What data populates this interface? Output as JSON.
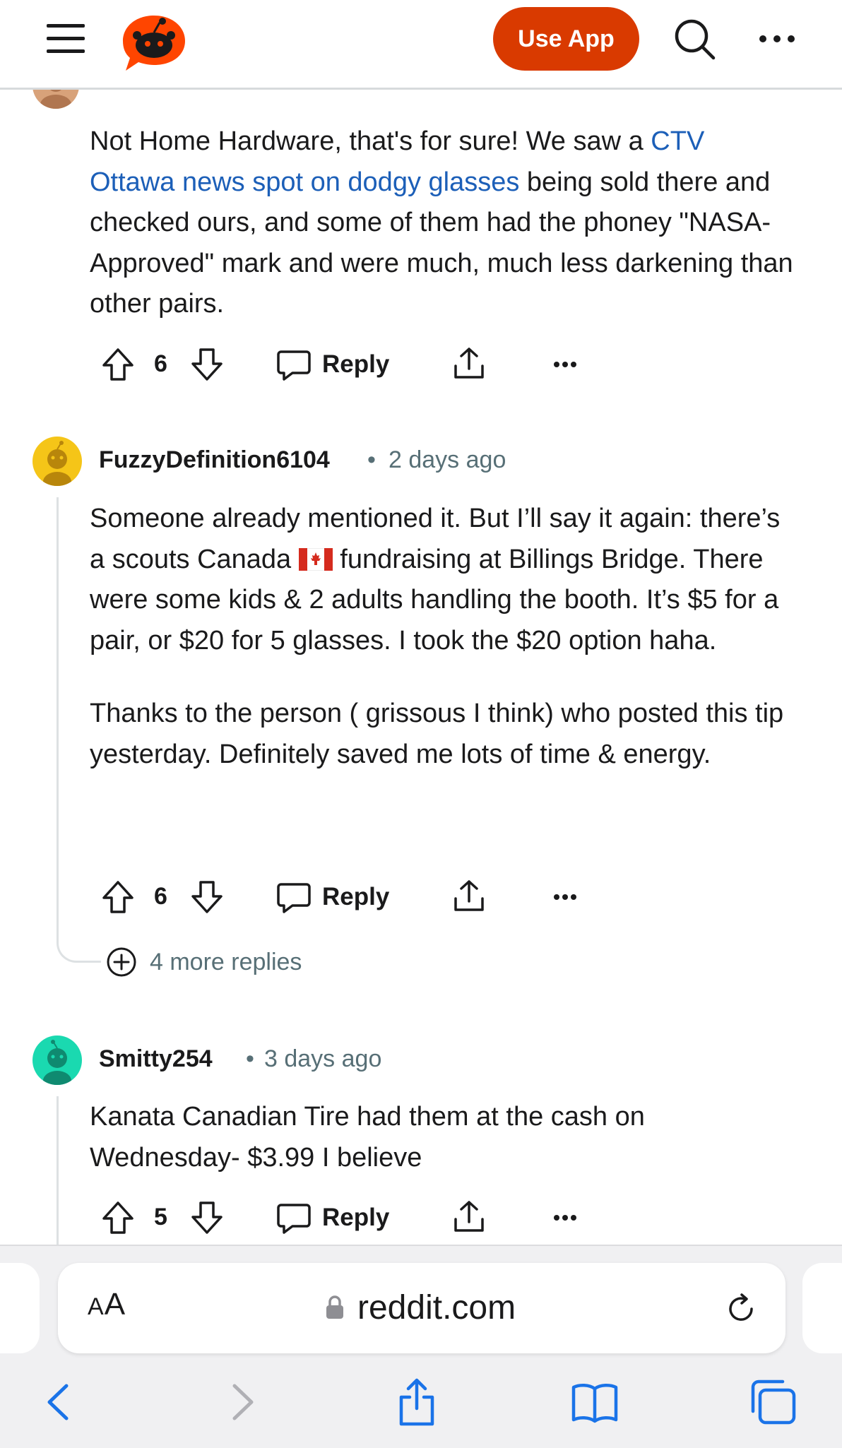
{
  "header": {
    "use_app_label": "Use App"
  },
  "comments": [
    {
      "id": "c1",
      "partial": true,
      "body_parts": [
        {
          "text": "Not Home Hardware, that's for sure! We saw a ",
          "link": false
        },
        {
          "text": "CTV Ottawa news spot on dodgy glasses",
          "link": true
        },
        {
          "text": " being sold there and checked ours, and some of them had the phoney \"NASA-Approved\" mark and were much, much less darkening than other pairs.",
          "link": false
        }
      ],
      "score": "6",
      "reply_label": "Reply"
    },
    {
      "id": "c2",
      "author": "FuzzyDefinition6104",
      "time": "2 days ago",
      "avatar_color": "#f5c518",
      "para1_a": "Someone already mentioned it. But I’ll say it again: there’s a scouts Canada ",
      "flag_emoji": "🇨🇦",
      "para1_b": " fundraising at Billings Bridge. There were some kids & 2 adults handling the booth. It’s $5 for a pair, or $20 for 5 glasses. I took the $20 option haha.",
      "para2": "Thanks to the person ( grissous I think) who posted this tip yesterday. Definitely saved me lots of time & energy.",
      "score": "6",
      "reply_label": "Reply",
      "more_replies": "4 more replies"
    },
    {
      "id": "c3",
      "author": "Smitty254",
      "time": "3 days ago",
      "avatar_color": "#1ad9b0",
      "body": "Kanata Canadian Tire had them at the cash on Wednesday- $3.99 I believe",
      "score": "5",
      "reply_label": "Reply"
    }
  ],
  "separator": "•",
  "browser": {
    "text_size_label_small": "A",
    "text_size_label_large": "A",
    "url": "reddit.com"
  },
  "colors": {
    "accent": "#d93a00",
    "link": "#1c5fb8",
    "meta": "#576f76",
    "safari_blue": "#1a73e8"
  }
}
